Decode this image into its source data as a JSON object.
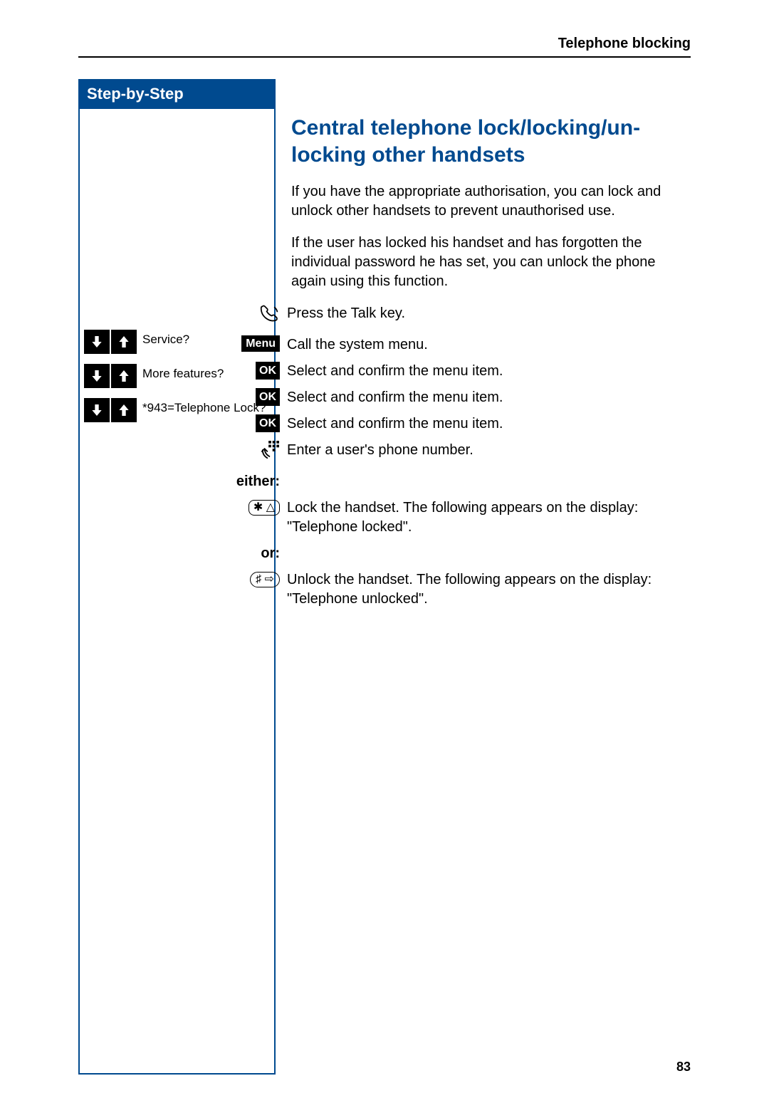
{
  "header": {
    "running_head": "Telephone blocking"
  },
  "sidebar": {
    "title": "Step-by-Step",
    "rows": [
      {
        "label": "Service?"
      },
      {
        "label": "More features?"
      },
      {
        "label": "*943=Telephone Lock?"
      }
    ]
  },
  "main": {
    "title": "Central telephone lock/locking/un­locking other handsets",
    "intro_1": "If you have the appropriate authorisation, you can lock and unlock other handsets to prevent unauthorised use.",
    "intro_2": "If the user has locked his handset and has forgotten the individual password he has set, you can unlock the phone again using this function.",
    "steps": {
      "talk": "Press the Talk key.",
      "menu": "Call the system menu.",
      "menu_badge": "Menu",
      "ok": "OK",
      "sel1": "Select and confirm the menu item.",
      "sel2": "Select and confirm the menu item.",
      "sel3": "Select and confirm the menu item.",
      "enter": "Enter a user's phone number.",
      "either_label": "either:",
      "lock": "Lock the handset. The following appears on the display: \"Telephone locked\".",
      "or_label": "or:",
      "unlock": "Unlock the handset. The following appears on the dis­play: \"Telephone unlocked\".",
      "star_key": "✱ △",
      "hash_key": "♯ ⇨"
    }
  },
  "page_number": "83"
}
